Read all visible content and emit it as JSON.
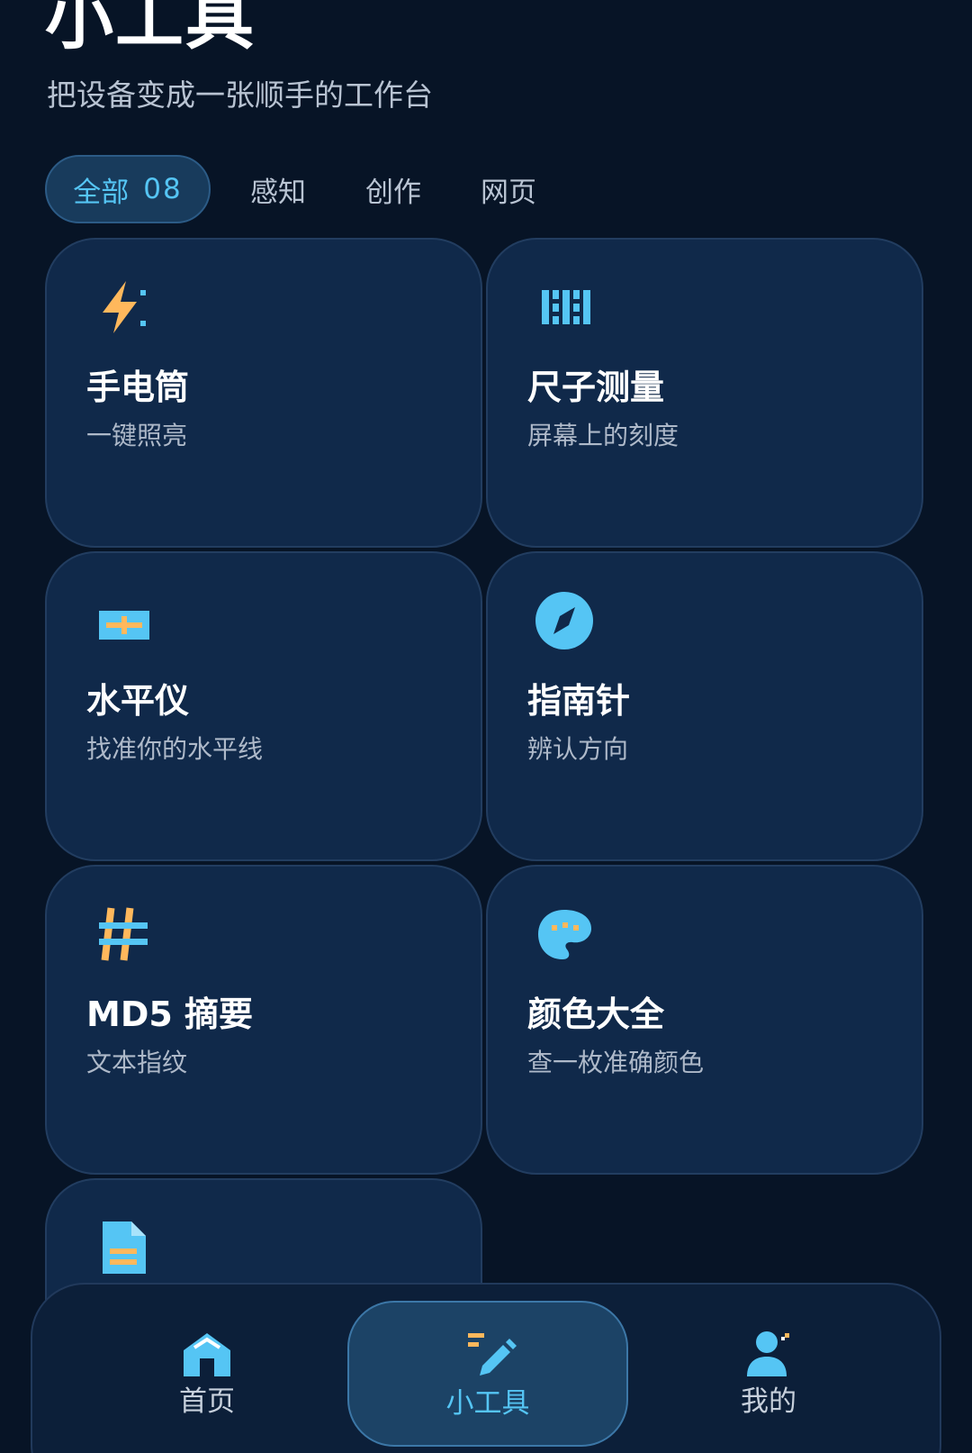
{
  "header": {
    "title": "小工具",
    "subtitle": "把设备变成一张顺手的工作台"
  },
  "filters": {
    "tabs": [
      {
        "label": "全部",
        "count": "08",
        "active": true
      },
      {
        "label": "感知",
        "active": false
      },
      {
        "label": "创作",
        "active": false
      },
      {
        "label": "网页",
        "active": false
      }
    ]
  },
  "tools": [
    {
      "title": "手电筒",
      "subtitle": "一键照亮",
      "icon": "flashlight-icon"
    },
    {
      "title": "尺子测量",
      "subtitle": "屏幕上的刻度",
      "icon": "ruler-icon"
    },
    {
      "title": "水平仪",
      "subtitle": "找准你的水平线",
      "icon": "level-icon"
    },
    {
      "title": "指南针",
      "subtitle": "辨认方向",
      "icon": "compass-icon"
    },
    {
      "title": "MD5 摘要",
      "subtitle": "文本指纹",
      "icon": "hash-icon"
    },
    {
      "title": "颜色大全",
      "subtitle": "查一枚准确颜色",
      "icon": "palette-icon"
    },
    {
      "title": "",
      "subtitle": "",
      "icon": "document-icon"
    }
  ],
  "bottom_nav": {
    "items": [
      {
        "label": "首页",
        "icon": "home-icon",
        "active": false
      },
      {
        "label": "小工具",
        "icon": "tools-icon",
        "active": true
      },
      {
        "label": "我的",
        "icon": "profile-icon",
        "active": false
      }
    ]
  },
  "colors": {
    "background": "#071426",
    "card": "#10294a",
    "accent": "#55c5f4",
    "orange": "#ffb85c"
  }
}
